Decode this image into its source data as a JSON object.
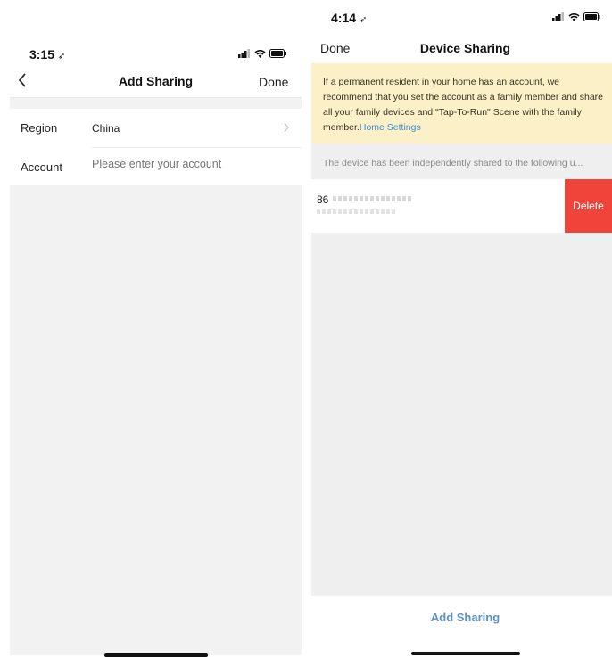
{
  "left": {
    "status_time": "3:15",
    "nav": {
      "back_label": "<",
      "title": "Add Sharing",
      "done_label": "Done"
    },
    "region_label": "Region",
    "region_value": "China",
    "account_label": "Account",
    "account_placeholder": "Please enter your account"
  },
  "right": {
    "status_time": "4:14",
    "nav": {
      "done_label": "Done",
      "title": "Device Sharing"
    },
    "banner_text": "If a permanent resident in your home has an account, we recommend that you set the account as a family member and share all your family devices and \"Tap-To-Run\" Scene with the family member.",
    "banner_link": "Home Settings",
    "shared_header": "The device has been independently shared to the following u...",
    "shared_user_prefix": "86",
    "delete_label": "Delete",
    "add_sharing_label": "Add Sharing"
  }
}
